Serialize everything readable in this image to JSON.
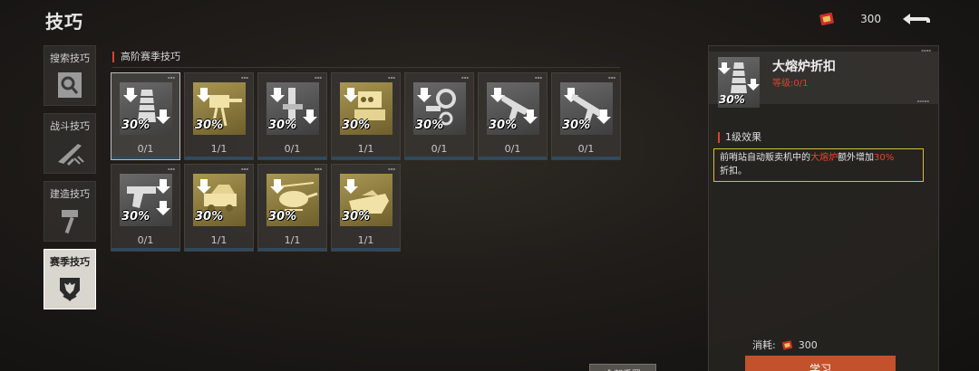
{
  "header": {
    "title": "技巧",
    "currency_amount": "300"
  },
  "sidebar": {
    "items": [
      {
        "label": "搜索技巧"
      },
      {
        "label": "战斗技巧"
      },
      {
        "label": "建造技巧"
      },
      {
        "label": "赛季技巧"
      }
    ]
  },
  "section": {
    "title": "高阶赛季技巧"
  },
  "cards": [
    {
      "pct": "30%",
      "level": "0/1"
    },
    {
      "pct": "30%",
      "level": "1/1"
    },
    {
      "pct": "30%",
      "level": "0/1"
    },
    {
      "pct": "30%",
      "level": "1/1"
    },
    {
      "pct": "30%",
      "level": "0/1"
    },
    {
      "pct": "30%",
      "level": "0/1"
    },
    {
      "pct": "30%",
      "level": "0/1"
    },
    {
      "pct": "30%",
      "level": "0/1"
    },
    {
      "pct": "30%",
      "level": "1/1"
    },
    {
      "pct": "30%",
      "level": "1/1"
    },
    {
      "pct": "30%",
      "level": "1/1"
    }
  ],
  "detail": {
    "pct": "30%",
    "name": "大熔炉折扣",
    "level": "等级:0/1",
    "effect_title": "1级效果",
    "effect_part1": "前哨站自动贩卖机中的",
    "effect_highlight1": "大熔炉",
    "effect_part2": "额外增加",
    "effect_highlight2": "30%",
    "effect_part3": "折扣。",
    "cost_label": "消耗:",
    "cost_amount": "300",
    "learn_label": "学习"
  },
  "footer": {
    "reset_label": "全部重置"
  },
  "colors": {
    "accent": "#d9432c",
    "gold": "#a89652",
    "highlight_border": "#d6c03a",
    "learn_button": "#c2512c"
  }
}
